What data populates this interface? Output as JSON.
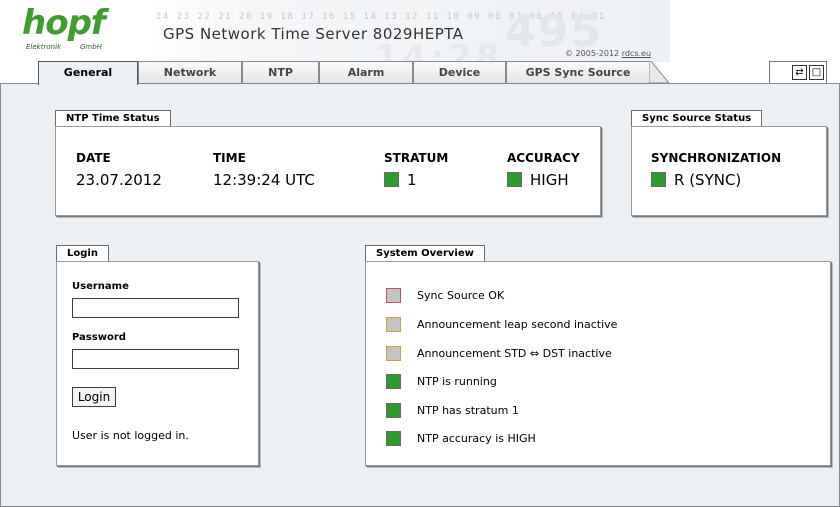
{
  "header": {
    "logo_text": "hopf",
    "logo_sub_left": "Elektronik",
    "logo_sub_right": "GmbH",
    "product_title": "GPS Network Time Server 8029HEPTA",
    "copyright_prefix": "© 2005-2012",
    "copyright_link": "rdcs.eu",
    "decor_digits": "24 23 22 21 20 19 18 17 16 15 14 13 12 11 10 09 08 07 06 05 04 01",
    "decor_big": "495",
    "decor_clock": "14:28"
  },
  "tabs": [
    {
      "label": "General",
      "active": true
    },
    {
      "label": "Network",
      "active": false
    },
    {
      "label": "NTP",
      "active": false
    },
    {
      "label": "Alarm",
      "active": false
    },
    {
      "label": "Device",
      "active": false
    },
    {
      "label": "GPS Sync Source",
      "active": false
    }
  ],
  "tools": {
    "refresh_icon": "⇄",
    "window_icon": "□"
  },
  "ntp_status": {
    "title": "NTP Time Status",
    "date_label": "DATE",
    "date_value": "23.07.2012",
    "time_label": "TIME",
    "time_value": "12:39:24 UTC",
    "stratum_label": "STRATUM",
    "stratum_value": "1",
    "accuracy_label": "ACCURACY",
    "accuracy_value": "HIGH"
  },
  "sync_source": {
    "title": "Sync Source Status",
    "label": "SYNCHRONIZATION",
    "value": "R (SYNC)"
  },
  "login": {
    "title": "Login",
    "username_label": "Username",
    "username_value": "",
    "password_label": "Password",
    "password_value": "",
    "button_label": "Login",
    "status_text": "User is not logged in."
  },
  "overview": {
    "title": "System Overview",
    "items": [
      {
        "text": "Sync Source OK",
        "indicator": "grey-red"
      },
      {
        "text": "Announcement leap second inactive",
        "indicator": "grey-orange"
      },
      {
        "text": "Announcement STD ⇔ DST inactive",
        "indicator": "grey-orange"
      },
      {
        "text": "NTP is running",
        "indicator": "green"
      },
      {
        "text": "NTP has stratum 1",
        "indicator": "green"
      },
      {
        "text": "NTP accuracy is HIGH",
        "indicator": "green"
      }
    ]
  },
  "colors": {
    "brand_green": "#3f9c2f",
    "status_green": "#2e9b2e",
    "panel_background": "#eaf0f4"
  }
}
